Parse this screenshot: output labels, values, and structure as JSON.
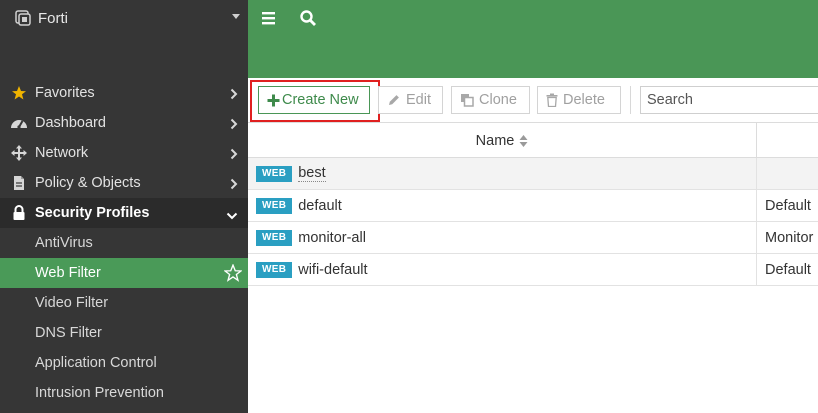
{
  "brand": {
    "name": "Forti"
  },
  "sidebar": {
    "items": [
      {
        "label": "Favorites"
      },
      {
        "label": "Dashboard"
      },
      {
        "label": "Network"
      },
      {
        "label": "Policy & Objects"
      },
      {
        "label": "Security Profiles"
      }
    ],
    "subitems": [
      {
        "label": "AntiVirus"
      },
      {
        "label": "Web Filter"
      },
      {
        "label": "Video Filter"
      },
      {
        "label": "DNS Filter"
      },
      {
        "label": "Application Control"
      },
      {
        "label": "Intrusion Prevention"
      }
    ]
  },
  "toolbar": {
    "create_label": "Create New",
    "edit_label": "Edit",
    "clone_label": "Clone",
    "delete_label": "Delete",
    "search_placeholder": "Search"
  },
  "table": {
    "columns": {
      "name": "Name"
    },
    "rows": [
      {
        "badge": "WEB",
        "name": "best",
        "col2": ""
      },
      {
        "badge": "WEB",
        "name": "default",
        "col2": "Default"
      },
      {
        "badge": "WEB",
        "name": "monitor-all",
        "col2": "Monitor"
      },
      {
        "badge": "WEB",
        "name": "wifi-default",
        "col2": "Default"
      }
    ]
  },
  "colors": {
    "topbar": "#4a9656",
    "sidebar": "#363636",
    "active_item": "#4a9a58",
    "badge": "#2a9fc2",
    "highlight": "#e02020"
  }
}
